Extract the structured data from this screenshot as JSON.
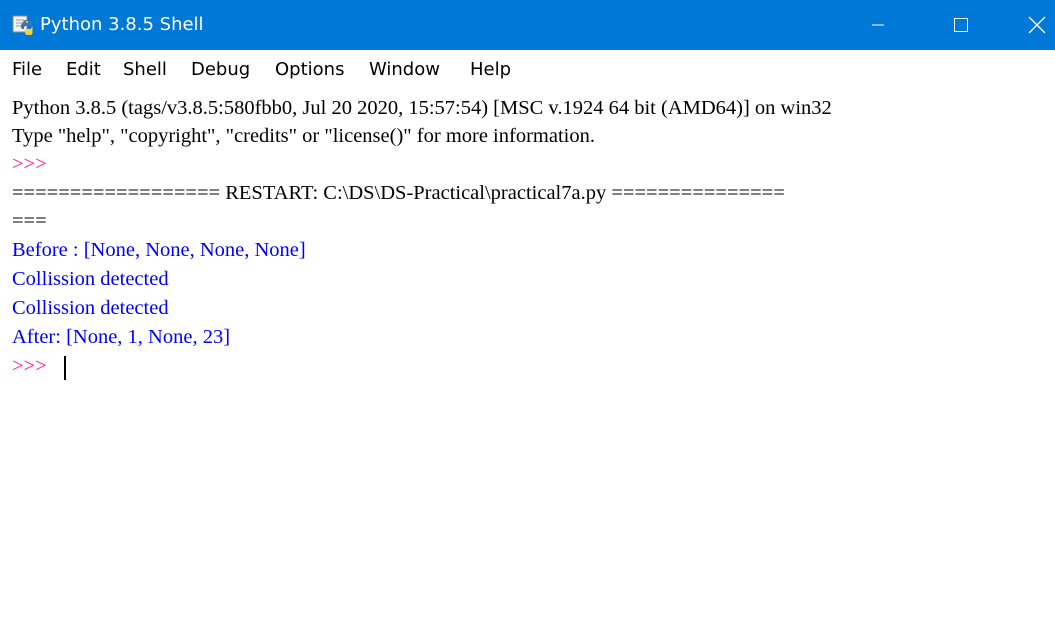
{
  "window": {
    "title": "Python 3.8.5 Shell",
    "title_bar_color": "#0078d7",
    "icon": "python-idle-icon",
    "controls": {
      "minimize_icon": "minimize-icon",
      "maximize_icon": "maximize-icon",
      "close_icon": "close-icon"
    }
  },
  "menu": [
    "File",
    "Edit",
    "Shell",
    "Debug",
    "Options",
    "Window",
    "Help"
  ],
  "shell": {
    "banner_line1": "Python 3.8.5 (tags/v3.8.5:580fbb0, Jul 20 2020, 15:57:54) [MSC v.1924 64 bit (AMD64)] on win32",
    "banner_line2": "Type \"help\", \"copyright\", \"credits\" or \"license()\" for more information.",
    "prompt1": ">>>",
    "restart_line": "================== RESTART: C:\\DS\\DS-Practical\\practical7a.py ===============",
    "restart_wrap": "===",
    "output": [
      "Before : [None, None, None, None]",
      "Collission detected",
      "Collission detected",
      "After: [None, 1, None, 23]"
    ],
    "prompt2": ">>>",
    "output_color": "#0000ff",
    "prompt_color": "#ff1493"
  }
}
